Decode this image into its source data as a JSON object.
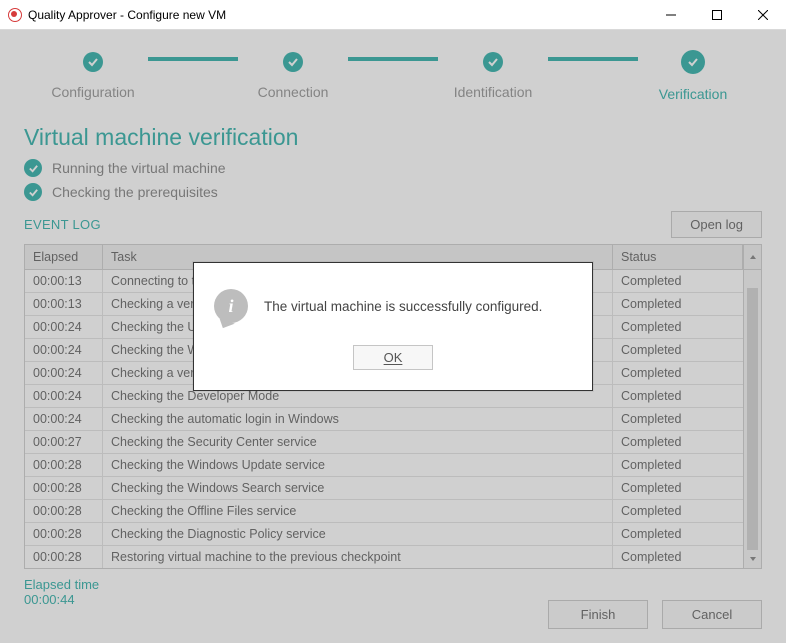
{
  "window": {
    "title": "Quality Approver - Configure new VM"
  },
  "stepper": {
    "steps": [
      {
        "label": "Configuration",
        "done": true,
        "active": false
      },
      {
        "label": "Connection",
        "done": true,
        "active": false
      },
      {
        "label": "Identification",
        "done": true,
        "active": false
      },
      {
        "label": "Verification",
        "done": true,
        "active": true
      }
    ]
  },
  "heading": "Virtual machine verification",
  "status_lines": [
    "Running the virtual machine",
    "Checking the prerequisites"
  ],
  "event_log": {
    "label": "EVENT LOG",
    "open_log_button": "Open log",
    "columns": {
      "elapsed": "Elapsed",
      "task": "Task",
      "status": "Status"
    },
    "rows": [
      {
        "elapsed": "00:00:13",
        "task": "Connecting to the PowerShell",
        "status": "Completed"
      },
      {
        "elapsed": "00:00:13",
        "task": "Checking a version of PowerShell",
        "status": "Completed"
      },
      {
        "elapsed": "00:00:24",
        "task": "Checking the User Account Control",
        "status": "Completed"
      },
      {
        "elapsed": "00:00:24",
        "task": "Checking the Windows Firewall",
        "status": "Completed"
      },
      {
        "elapsed": "00:00:24",
        "task": "Checking a version of .NET Framework",
        "status": "Completed"
      },
      {
        "elapsed": "00:00:24",
        "task": "Checking the Developer Mode",
        "status": "Completed"
      },
      {
        "elapsed": "00:00:24",
        "task": "Checking the automatic login in Windows",
        "status": "Completed"
      },
      {
        "elapsed": "00:00:27",
        "task": "Checking the Security Center service",
        "status": "Completed"
      },
      {
        "elapsed": "00:00:28",
        "task": "Checking the Windows Update service",
        "status": "Completed"
      },
      {
        "elapsed": "00:00:28",
        "task": "Checking the Windows Search service",
        "status": "Completed"
      },
      {
        "elapsed": "00:00:28",
        "task": "Checking the Offline Files service",
        "status": "Completed"
      },
      {
        "elapsed": "00:00:28",
        "task": "Checking the Diagnostic Policy service",
        "status": "Completed"
      },
      {
        "elapsed": "00:00:28",
        "task": "Restoring virtual machine to the previous checkpoint",
        "status": "Completed"
      }
    ]
  },
  "elapsed": {
    "label": "Elapsed time",
    "value": "00:00:44"
  },
  "footer": {
    "finish": "Finish",
    "cancel": "Cancel"
  },
  "modal": {
    "message": "The virtual machine is successfully configured.",
    "ok": "OK"
  }
}
